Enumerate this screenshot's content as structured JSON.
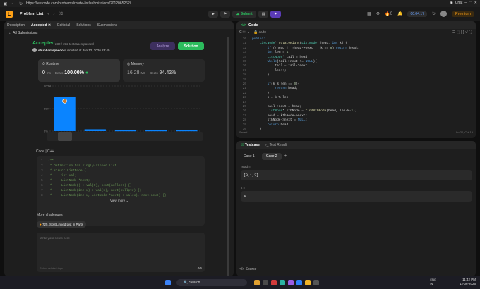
{
  "browser": {
    "url": "https://leetcode.com/problems/rotate-list/submissions/2012065262/",
    "chat_label": "Chat"
  },
  "nav": {
    "title": "Problem List",
    "submit_label": "Submit",
    "timer": "00:04:17",
    "streak": "0",
    "premium_label": "Premium"
  },
  "left_tabs": [
    {
      "label": "Description"
    },
    {
      "label": "Accepted"
    },
    {
      "label": "Editorial"
    },
    {
      "label": "Solutions"
    },
    {
      "label": "Submissions"
    }
  ],
  "submission": {
    "all_subs": "All Submissions",
    "status": "Accepted",
    "passed": "232 / 232 testcases passed",
    "user": "shubhamspeedo",
    "submitted_at": "submitted at Jan 12, 2026 23:40",
    "analyze_label": "Analyze",
    "solution_label": "Solution",
    "runtime_label": "Runtime",
    "runtime_value": "0",
    "runtime_unit": "ms",
    "runtime_beats_label": "Beats",
    "runtime_beats": "100.00%",
    "memory_label": "Memory",
    "memory_value": "16.28",
    "memory_unit": "MB",
    "memory_beats_label": "Beats",
    "memory_beats": "94.42%"
  },
  "chart_data": {
    "type": "bar",
    "categories": [
      "0ms",
      "1ms",
      "2ms",
      "3ms",
      "4ms"
    ],
    "values": [
      76,
      4,
      2,
      2,
      2
    ],
    "ylim": [
      0,
      100
    ],
    "y_ticks": [
      "100%",
      "50%",
      "0%"
    ],
    "x_labels": [
      "0ms",
      "1ms",
      "2ms",
      "3ms",
      "4ms"
    ],
    "highlight_color": "#0a84ff",
    "bar_color": "#0a84ff"
  },
  "code_section": {
    "label": "Code",
    "lang": "C++",
    "lines": [
      {
        "n": "1",
        "t": "/**"
      },
      {
        "n": "2",
        "t": " * Definition for singly-linked list."
      },
      {
        "n": "3",
        "t": " * struct ListNode {"
      },
      {
        "n": "4",
        "t": " *     int val;"
      },
      {
        "n": "5",
        "t": " *     ListNode *next;"
      },
      {
        "n": "6",
        "t": " *     ListNode() : val(0), next(nullptr) {}"
      },
      {
        "n": "7",
        "t": " *     ListNode(int x) : val(x), next(nullptr) {}"
      },
      {
        "n": "8",
        "t": " *     ListNode(int x, ListNode *next) : val(x), next(next) {}"
      }
    ],
    "view_more": "View more"
  },
  "more": {
    "label": "More challenges",
    "chip": "725. Split Linked List in Parts",
    "notes_placeholder": "Write your notes here",
    "tags_placeholder": "Select related tags",
    "count": "0/5"
  },
  "editor": {
    "title": "Code",
    "lang": "C++",
    "auto": "Auto",
    "saved": "Saved",
    "position": "Ln 20, Col 19",
    "lines": [
      {
        "n": "10",
        "t": "public:"
      },
      {
        "n": "11",
        "t": "    ListNode* rotateRight(ListNode* head, int k) {"
      },
      {
        "n": "12",
        "t": "        if (!head || !head->next || k == 0) return head;"
      },
      {
        "n": "13",
        "t": "        int len = 1;"
      },
      {
        "n": "14",
        "t": "        ListNode* tail = head;"
      },
      {
        "n": "15",
        "t": "        while(tail->next != NULL){"
      },
      {
        "n": "16",
        "t": "            tail = tail->next;"
      },
      {
        "n": "17",
        "t": "            len++;"
      },
      {
        "n": "18",
        "t": "        }"
      },
      {
        "n": "19",
        "t": ""
      },
      {
        "n": "20",
        "t": "        if(k % len == 0){"
      },
      {
        "n": "21",
        "t": "            return head;"
      },
      {
        "n": "22",
        "t": "        }"
      },
      {
        "n": "23",
        "t": "        k = k % len;"
      },
      {
        "n": "24",
        "t": ""
      },
      {
        "n": "25",
        "t": "        tail->next = head;"
      },
      {
        "n": "26",
        "t": "        ListNode* kthNode = findNthNode(head, len-k-1);"
      },
      {
        "n": "27",
        "t": "        head = kthNode->next;"
      },
      {
        "n": "28",
        "t": "        kthNode->next = NULL;"
      },
      {
        "n": "29",
        "t": "        return head;"
      },
      {
        "n": "30",
        "t": "    }"
      }
    ]
  },
  "testcase": {
    "title": "Testcase",
    "result_tab": "Test Result",
    "case1": "Case 1",
    "case2": "Case 2",
    "head_label": "head =",
    "head_value": "[0,1,2]",
    "k_label": "k =",
    "k_value": "4",
    "source_label": "Source"
  },
  "taskbar": {
    "search_placeholder": "Search",
    "lang1": "ENG",
    "lang2": "IN",
    "time": "11:42 PM",
    "date": "12-06-2026"
  }
}
